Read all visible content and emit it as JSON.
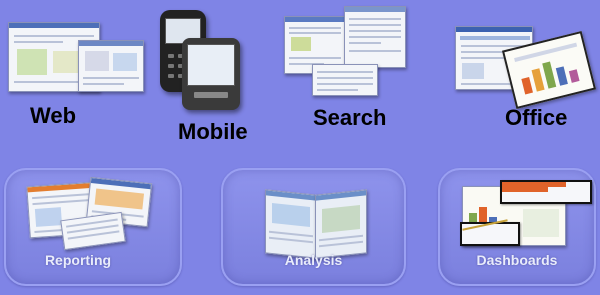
{
  "channels": {
    "web": {
      "label": "Web",
      "icon": "web-browser-screenshot-icon"
    },
    "mobile": {
      "label": "Mobile",
      "icon": "mobile-phone-icon"
    },
    "search": {
      "label": "Search",
      "icon": "search-results-screenshot-icon"
    },
    "office": {
      "label": "Office",
      "icon": "office-document-screenshot-icon"
    }
  },
  "capabilities": [
    {
      "label": "Reporting",
      "icon": "report-screenshots-icon"
    },
    {
      "label": "Analysis",
      "icon": "analysis-screenshots-icon"
    },
    {
      "label": "Dashboards",
      "icon": "dashboard-screenshots-icon"
    }
  ],
  "colors": {
    "background": "#7f84e6",
    "tile_fill": "#8b90ea",
    "label_text": "#000000",
    "tile_label_text": "#e9ecfb",
    "accent_blue": "#4d6fb8",
    "chart_orange": "#e0632a"
  }
}
